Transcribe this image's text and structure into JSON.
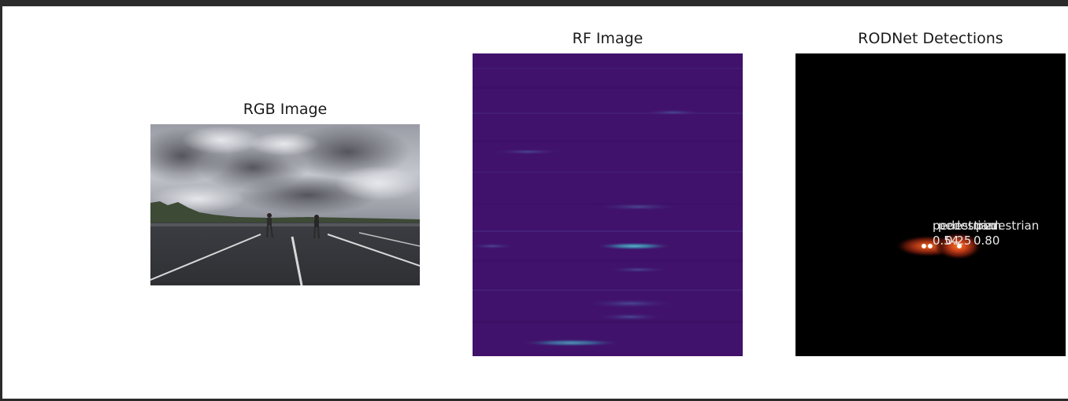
{
  "panels": {
    "rgb": {
      "title": "RGB Image"
    },
    "rf": {
      "title": "RF Image"
    },
    "detections": {
      "title": "RODNet Detections",
      "items": [
        {
          "class": "pedestrian",
          "score": "0.54"
        },
        {
          "class": "pedestrian",
          "score": "0.25"
        },
        {
          "class": "pedestrian",
          "score": "0.80"
        }
      ]
    }
  },
  "colors": {
    "rf_background": "#40126b",
    "rf_highlight": "#4fa0c8",
    "detection_glow": "#ff6a1a",
    "detection_background": "#000000"
  }
}
